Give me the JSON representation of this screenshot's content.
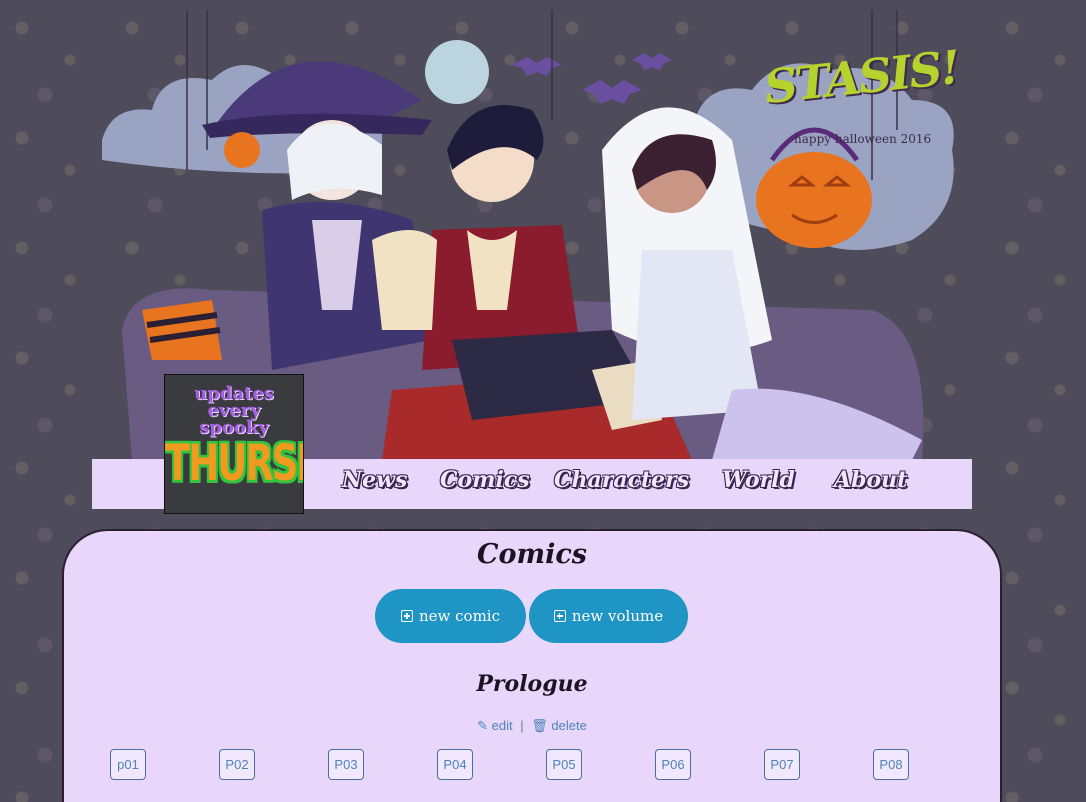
{
  "banner": {
    "logo": "STASIS!",
    "logo_subtitle": "happy halloween 2016"
  },
  "updates_badge": {
    "line1": "updates",
    "line2": "every",
    "line3": "spooky",
    "line4": "THURSDAY"
  },
  "nav": {
    "items": [
      {
        "label": "News"
      },
      {
        "label": "Comics"
      },
      {
        "label": "Characters"
      },
      {
        "label": "World"
      },
      {
        "label": "About"
      }
    ]
  },
  "main": {
    "title": "Comics",
    "buttons": {
      "new_comic": "new comic",
      "new_volume": "new volume"
    },
    "volume": {
      "title": "Prologue",
      "edit_label": "edit",
      "separator": "|",
      "delete_label": "delete",
      "pages": [
        "p01",
        "P02",
        "P03",
        "P04",
        "P05",
        "P06",
        "P07",
        "P08"
      ]
    }
  },
  "colors": {
    "background": "#4e4b5a",
    "card": "#e9d7fb",
    "button": "#1f95c5",
    "link": "#4d84b8"
  }
}
